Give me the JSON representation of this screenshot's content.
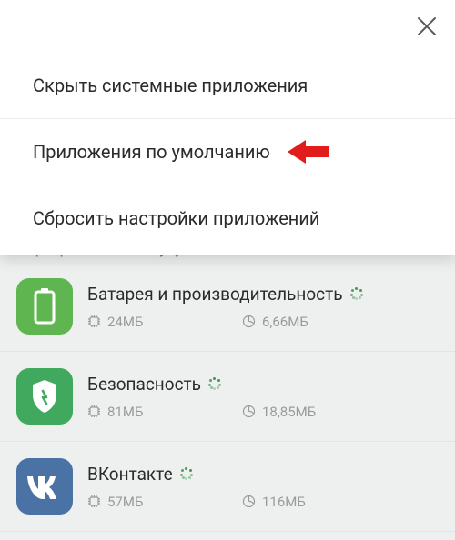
{
  "menu": {
    "items": [
      {
        "label": "Скрыть системные приложения"
      },
      {
        "label": "Приложения по умолчанию",
        "highlighted": true
      },
      {
        "label": "Сбросить настройки приложений"
      }
    ]
  },
  "sort": {
    "label": "Сортировка по статусу"
  },
  "apps": [
    {
      "name": "Батарея и производительность",
      "storage": "24МБ",
      "data": "6,66МБ",
      "icon": "battery"
    },
    {
      "name": "Безопасность",
      "storage": "81МБ",
      "data": "18,85МБ",
      "icon": "shield"
    },
    {
      "name": "ВКонтакте",
      "storage": "57МБ",
      "data": "116МБ",
      "icon": "vk"
    }
  ],
  "colors": {
    "highlight_arrow": "#e21b1b",
    "app_green": "#5fb550",
    "app_green2": "#41a95d",
    "vk_blue": "#4b72a4"
  }
}
